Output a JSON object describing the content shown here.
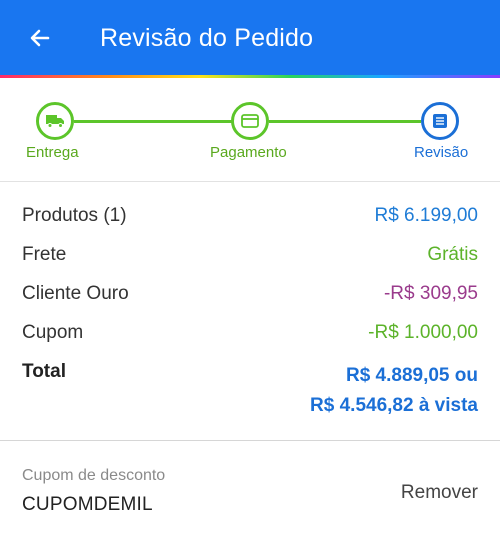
{
  "header": {
    "title": "Revisão do Pedido",
    "back_icon": "arrow-left-icon",
    "background": "#1976f0"
  },
  "stepper": {
    "steps": [
      {
        "label": "Entrega",
        "icon": "truck-icon",
        "state": "completed"
      },
      {
        "label": "Pagamento",
        "icon": "credit-card-icon",
        "state": "completed"
      },
      {
        "label": "Revisão",
        "icon": "list-icon",
        "state": "current"
      }
    ],
    "completed_color": "#5cc52a",
    "current_color": "#1b6fd6"
  },
  "summary": {
    "products": {
      "label": "Produtos (1)",
      "value": "R$ 6.199,00"
    },
    "shipping": {
      "label": "Frete",
      "value": "Grátis"
    },
    "gold_client": {
      "label": "Cliente Ouro",
      "value": "-R$ 309,95"
    },
    "coupon": {
      "label": "Cupom",
      "value": "-R$ 1.000,00"
    },
    "total": {
      "label": "Total",
      "value_line1": "R$ 4.889,05 ou",
      "value_line2": "R$ 4.546,82 à vista"
    }
  },
  "coupon": {
    "caption": "Cupom de desconto",
    "code": "CUPOMDEMIL",
    "remove_label": "Remover"
  }
}
